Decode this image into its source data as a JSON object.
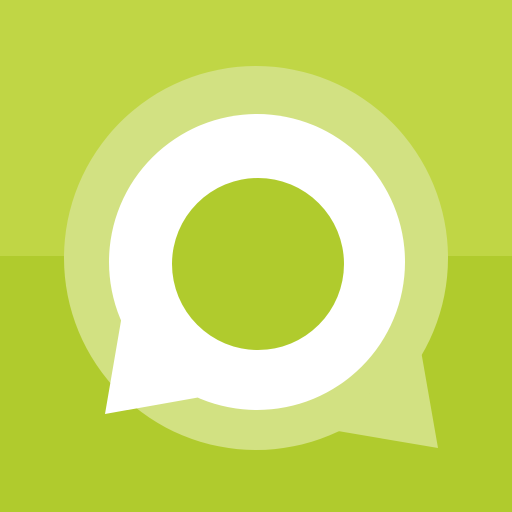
{
  "icon": {
    "name": "chat-bubble-icon",
    "colors": {
      "background_top": "#c0d645",
      "background_bottom": "#b0cb2d",
      "back_bubble": "#d2e182",
      "front_bubble": "#ffffff",
      "center_dot": "#b0cb2d"
    }
  }
}
